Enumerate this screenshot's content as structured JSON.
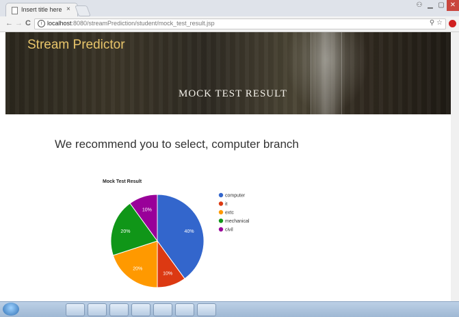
{
  "browser": {
    "tab_title": "Insert title here",
    "tab_close": "×",
    "url_host": "localhost",
    "url_path": ":8080/streamPrediction/student/mock_test_result.jsp",
    "info_glyph": "i",
    "zoom_glyph": "⚲",
    "star_glyph": "☆",
    "back_glyph": "←",
    "forward_glyph": "→",
    "reload_glyph": "C"
  },
  "header": {
    "brand": "Stream Predictor",
    "title": "MOCK TEST RESULT"
  },
  "main": {
    "recommendation": "We recommend you to select, computer branch"
  },
  "chart_data": {
    "type": "pie",
    "title": "Mock Test Result",
    "slices": [
      {
        "label": "computer",
        "value": 40,
        "color": "#3366cc"
      },
      {
        "label": "it",
        "value": 10,
        "color": "#dc3912"
      },
      {
        "label": "extc",
        "value": 20,
        "color": "#ff9900"
      },
      {
        "label": "mechanical",
        "value": 20,
        "color": "#109618"
      },
      {
        "label": "civil",
        "value": 10,
        "color": "#990099"
      }
    ],
    "legend_position": "right"
  }
}
